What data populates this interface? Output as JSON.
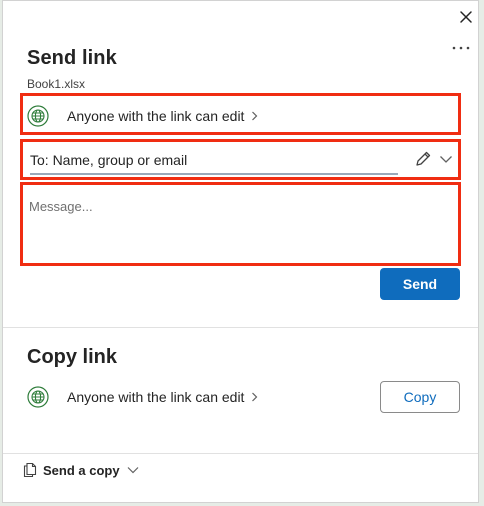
{
  "dialog": {
    "title": "Send link",
    "filename": "Book1.xlsx",
    "close_icon": "close-icon",
    "more_icon": "more-options-icon"
  },
  "send_section": {
    "permission_label": "Anyone with the link can edit",
    "to_placeholder": "To: Name, group or email",
    "message_placeholder": "Message...",
    "send_label": "Send"
  },
  "copy_section": {
    "title": "Copy link",
    "permission_label": "Anyone with the link can edit",
    "copy_label": "Copy"
  },
  "footer": {
    "send_copy_label": "Send a copy"
  },
  "colors": {
    "accent": "#0f6cbd",
    "highlight": "#f02d12",
    "globe": "#2f7d3b"
  }
}
